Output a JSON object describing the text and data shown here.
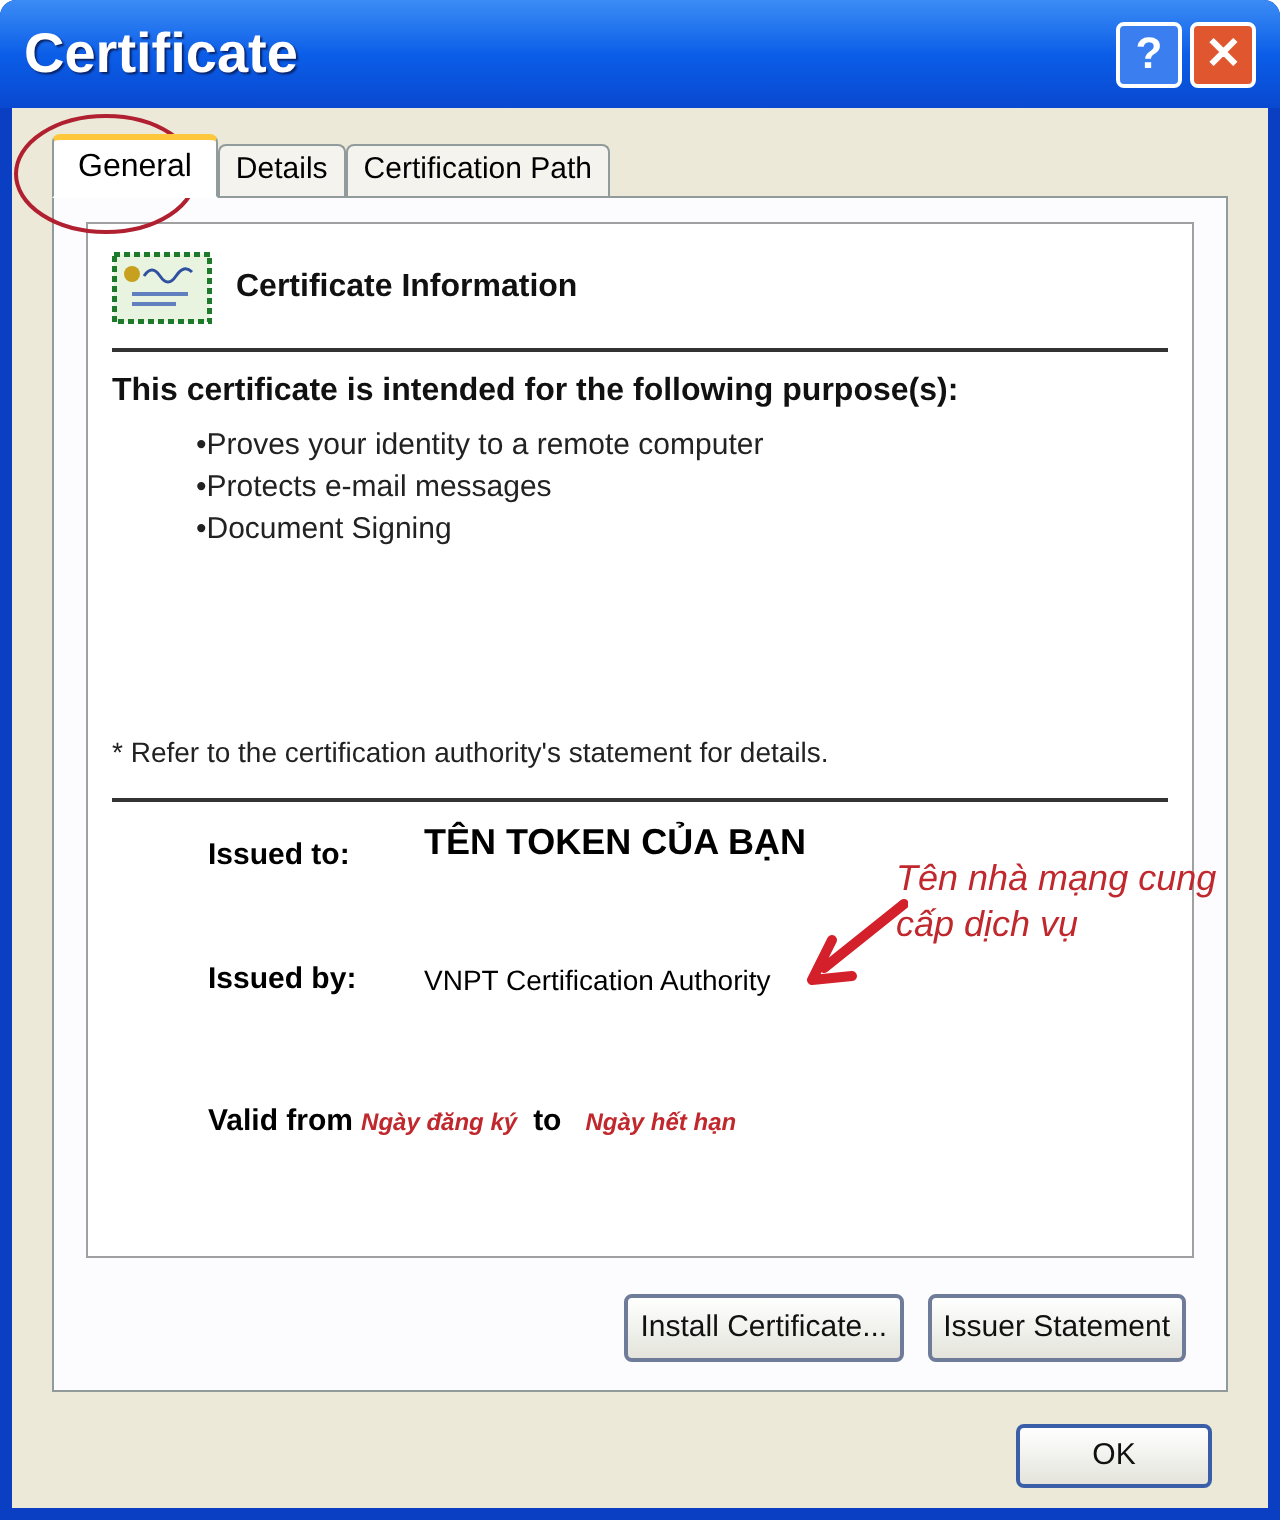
{
  "window": {
    "title": "Certificate",
    "buttons": [
      {
        "kind": "help",
        "label": "?"
      },
      {
        "kind": "close",
        "label": "✕"
      }
    ]
  },
  "tabs": [
    {
      "label": "General",
      "selected": true
    },
    {
      "label": "Details",
      "selected": false
    },
    {
      "label": "Certification Path",
      "selected": false
    }
  ],
  "certificate": {
    "heading": "Certificate Information",
    "purpose_heading": "This certificate is intended for the following purpose(s):",
    "purposes": [
      "•Proves your identity to a remote computer",
      "•Protects e-mail messages",
      "•Document Signing"
    ],
    "note": "* Refer to the certification authority's statement for details.",
    "issued_to": {
      "label": "Issued to:",
      "value": "TÊN TOKEN CỦA BẠN"
    },
    "issued_by": {
      "label": "Issued by:",
      "value": "VNPT Certification Authority"
    },
    "valid": {
      "from_label": "Valid from",
      "from": "Ngày đăng ký",
      "to_label": "to",
      "to": "Ngày hết hạn"
    }
  },
  "annotation": {
    "text": "Tên nhà mạng cung cấp dịch vụ"
  },
  "page_buttons": [
    "Install Certificate...",
    "Issuer Statement"
  ],
  "ok_button": "OK"
}
